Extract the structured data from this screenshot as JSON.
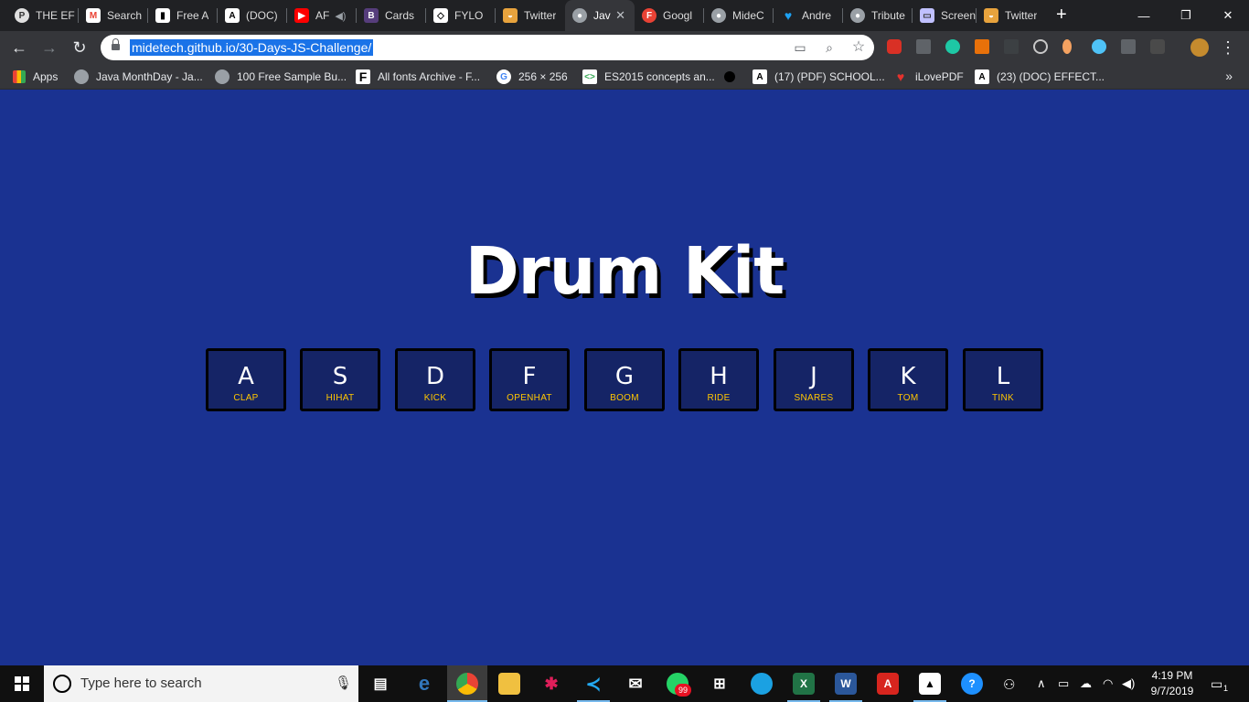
{
  "browser": {
    "tabs": [
      {
        "title": "THE EF",
        "icon": "site-icon",
        "color": "#e0e0e0"
      },
      {
        "title": "Search",
        "icon": "gmail-icon",
        "color": "#ea4335"
      },
      {
        "title": "Free A",
        "icon": "book-icon",
        "color": "#ffffff"
      },
      {
        "title": "(DOC)",
        "icon": "academia-icon",
        "color": "#ffffff"
      },
      {
        "title": "AF",
        "icon": "youtube-icon",
        "color": "#ff0000"
      },
      {
        "title": "Cards",
        "icon": "bootstrap-icon",
        "color": "#563d7c"
      },
      {
        "title": "FYLO",
        "icon": "codepen-icon",
        "color": "#ffffff"
      },
      {
        "title": "Twitter",
        "icon": "twitter-logo-icon",
        "color": "#e8a33d"
      },
      {
        "title": "Jav",
        "icon": "globe-icon",
        "color": "#9aa0a6"
      },
      {
        "title": "Googl",
        "icon": "fonts-icon",
        "color": "#e94235"
      },
      {
        "title": "MideC",
        "icon": "globe-icon",
        "color": "#9aa0a6"
      },
      {
        "title": "Andre",
        "icon": "twitter-icon",
        "color": "#1da1f2"
      },
      {
        "title": "Tribute",
        "icon": "globe-icon",
        "color": "#9aa0a6"
      },
      {
        "title": "Screen",
        "icon": "screen-icon",
        "color": "#c0c0ff"
      },
      {
        "title": "Twitter",
        "icon": "twitter-logo-icon",
        "color": "#e8a33d"
      }
    ],
    "active_tab_index": 8,
    "url": "midetech.github.io/30-Days-JS-Challenge/",
    "bookmarks": [
      {
        "label": "Apps",
        "icon": "apps-grid-icon"
      },
      {
        "label": "Java MonthDay - Ja...",
        "icon": "globe-icon"
      },
      {
        "label": "100 Free Sample Bu...",
        "icon": "globe-icon"
      },
      {
        "label": "All fonts Archive - F...",
        "icon": "fonts-archive-icon"
      },
      {
        "label": "256 × 256",
        "icon": "google-icon"
      },
      {
        "label": "ES2015 concepts an...",
        "icon": "code-icon"
      },
      {
        "label": "",
        "icon": "drop-icon"
      },
      {
        "label": "(17) (PDF) SCHOOL...",
        "icon": "academia-icon"
      },
      {
        "label": "iLovePDF",
        "icon": "heart-icon"
      },
      {
        "label": "(23) (DOC) EFFECT...",
        "icon": "academia-icon"
      }
    ]
  },
  "page": {
    "title": "Drum Kit",
    "keys": [
      {
        "key": "A",
        "sound": "CLAP"
      },
      {
        "key": "S",
        "sound": "HIHAT"
      },
      {
        "key": "D",
        "sound": "KICK"
      },
      {
        "key": "F",
        "sound": "OPENHAT"
      },
      {
        "key": "G",
        "sound": "BOOM"
      },
      {
        "key": "H",
        "sound": "RIDE"
      },
      {
        "key": "J",
        "sound": "SNARES"
      },
      {
        "key": "K",
        "sound": "TOM"
      },
      {
        "key": "L",
        "sound": "TINK"
      }
    ],
    "colors": {
      "background": "#1a3291",
      "key_letter": "#ffffff",
      "key_sound": "#ffc600"
    }
  },
  "taskbar": {
    "search_placeholder": "Type here to search",
    "whatsapp_badge": "99",
    "time": "4:19 PM",
    "date": "9/7/2019",
    "notifications": "1"
  }
}
